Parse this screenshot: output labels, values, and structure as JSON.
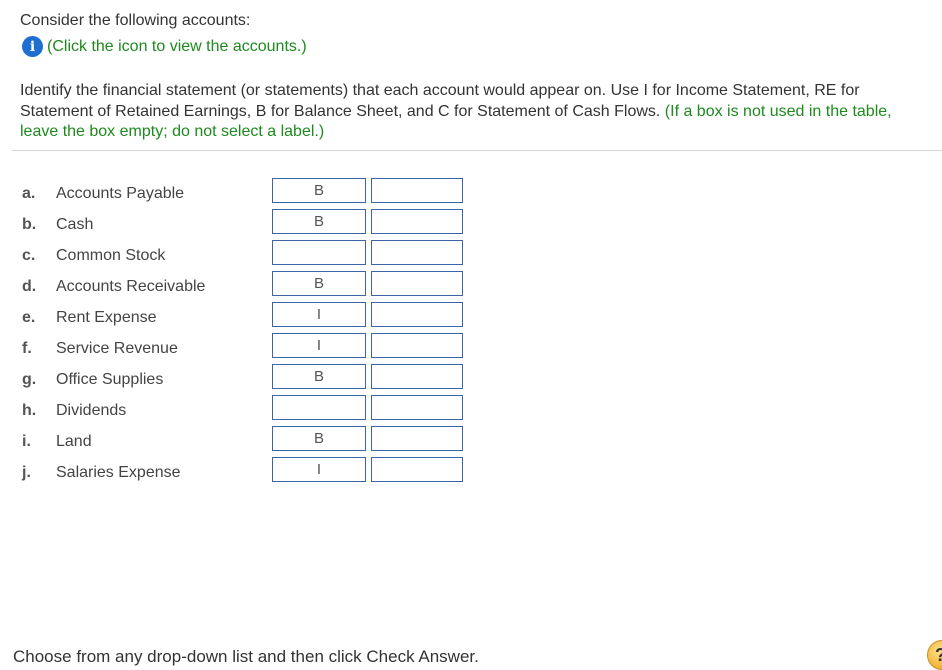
{
  "intro": {
    "text": "Consider the following accounts:",
    "info_icon": "info-icon",
    "info_link": "(Click the icon to view the accounts.)"
  },
  "instructions": {
    "main": "Identify the financial statement (or statements) that each account would appear on. Use I for Income Statement, RE for Statement of Retained Earnings, B for Balance Sheet, and C for Statement of Cash Flows.",
    "note": "(If a box is not used in the table, leave the box empty; do not select a label.)"
  },
  "accounts": [
    {
      "letter": "a.",
      "name": "Accounts Payable",
      "box1": "B",
      "box2": ""
    },
    {
      "letter": "b.",
      "name": "Cash",
      "box1": "B",
      "box2": ""
    },
    {
      "letter": "c.",
      "name": "Common Stock",
      "box1": "",
      "box2": ""
    },
    {
      "letter": "d.",
      "name": "Accounts Receivable",
      "box1": "B",
      "box2": ""
    },
    {
      "letter": "e.",
      "name": "Rent Expense",
      "box1": "I",
      "box2": ""
    },
    {
      "letter": "f.",
      "name": "Service Revenue",
      "box1": "I",
      "box2": ""
    },
    {
      "letter": "g.",
      "name": "Office Supplies",
      "box1": "B",
      "box2": ""
    },
    {
      "letter": "h.",
      "name": "Dividends",
      "box1": "",
      "box2": ""
    },
    {
      "letter": "i.",
      "name": "Land",
      "box1": "B",
      "box2": ""
    },
    {
      "letter": "j.",
      "name": "Salaries Expense",
      "box1": "I",
      "box2": ""
    }
  ],
  "footer": {
    "text": "Choose from any drop-down list and then click Check Answer.",
    "help_icon_glyph": "?"
  },
  "colors": {
    "green_text": "#1e8a1e",
    "box_border": "#3e64a8",
    "info_icon": "#1f6fd0"
  }
}
